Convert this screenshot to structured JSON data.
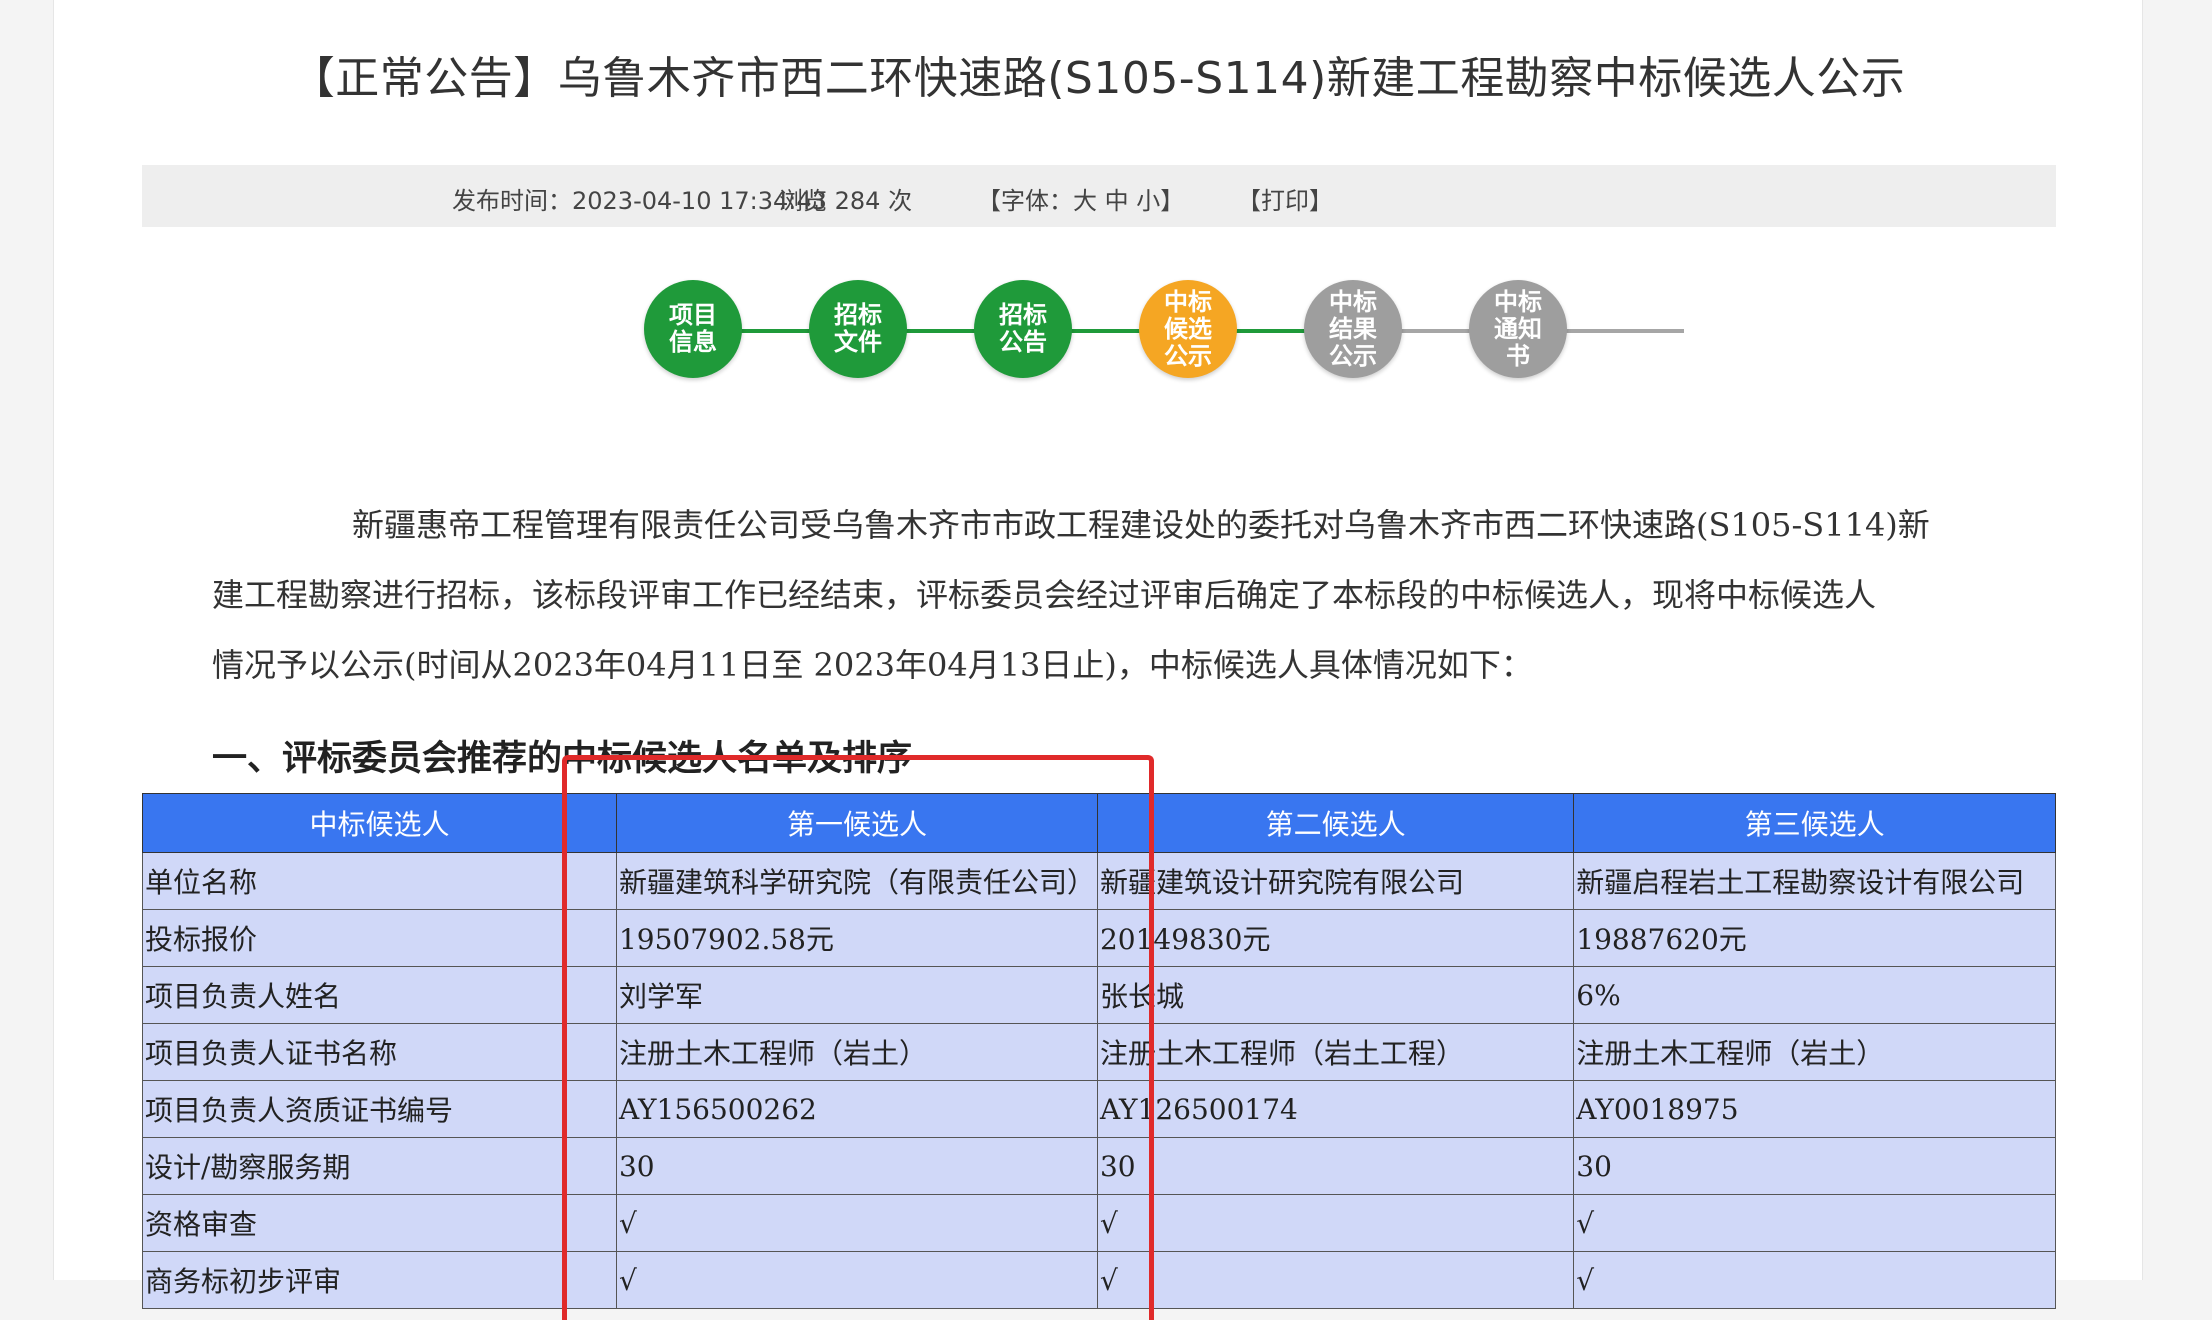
{
  "title": "【正常公告】乌鲁木齐市西二环快速路(S105-S114)新建工程勘察中标候选人公示",
  "meta": {
    "publish_time": "发布时间：2023-04-10 17:34:43",
    "views": "浏览 284 次",
    "font_size": "【字体：大 中 小】",
    "print": "【打印】"
  },
  "steps": [
    {
      "label": "项目信息",
      "color": "#1f9a3a"
    },
    {
      "label": "招标文件",
      "color": "#1f9a3a"
    },
    {
      "label": "招标公告",
      "color": "#1f9a3a"
    },
    {
      "label": "中标候选公示",
      "color": "#f5a623"
    },
    {
      "label": "中标结果公示",
      "color": "#9e9e9e"
    },
    {
      "label": "中标通知书",
      "color": "#9e9e9e"
    }
  ],
  "content": {
    "line1": "新疆惠帝工程管理有限责任公司受乌鲁木齐市市政工程建设处的委托对乌鲁木齐市西二环快速路(S105-S114)新",
    "line2": "建工程勘察进行招标，该标段评审工作已经结束，评标委员会经过评审后确定了本标段的中标候选人，现将中标候选人",
    "line3": "情况予以公示(时间从2023年04月11日至 2023年04月13日止)，中标候选人具体情况如下：",
    "section_title": "一、评标委员会推荐的中标候选人名单及排序"
  },
  "table": {
    "headers": [
      "中标候选人",
      "第一候选人",
      "第二候选人",
      "第三候选人"
    ],
    "rows": [
      [
        "单位名称",
        "新疆建筑科学研究院（有限责任公司）",
        "新疆建筑设计研究院有限公司",
        "新疆启程岩土工程勘察设计有限公司"
      ],
      [
        "投标报价",
        "19507902.58元",
        "20149830元",
        "19887620元"
      ],
      [
        "项目负责人姓名",
        "刘学军",
        "张长城",
        "6%"
      ],
      [
        "项目负责人证书名称",
        "注册土木工程师（岩土）",
        "注册土木工程师（岩土工程）",
        "注册土木工程师（岩土）"
      ],
      [
        "项目负责人资质证书编号",
        "AY156500262",
        "AY126500174",
        "AY0018975"
      ],
      [
        "设计/勘察服务期",
        "30",
        "30",
        "30"
      ],
      [
        "资格审查",
        "√",
        "√",
        "√"
      ],
      [
        "商务标初步评审",
        "√",
        "√",
        "√"
      ]
    ]
  },
  "colors": {
    "header_blue": "#2f6ff0",
    "cell_bg": "#d0d8f8",
    "highlight_red": "#e02a2a",
    "done_green": "#1f9a3a",
    "current_orange": "#f5a623",
    "pending_gray": "#9e9e9e"
  }
}
